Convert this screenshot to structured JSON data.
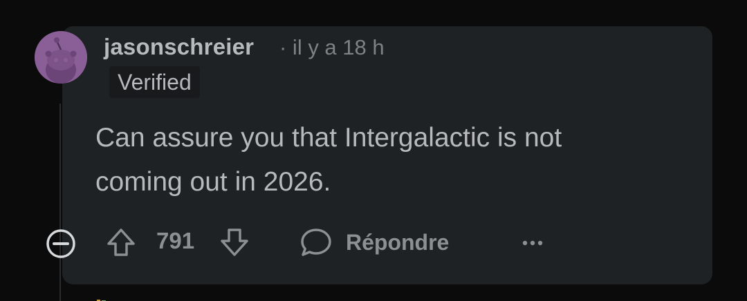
{
  "comment": {
    "username": "jasonschreier",
    "meta": "· il y a 18 h",
    "flair": "Verified",
    "body_line1": "Can assure you that Intergalactic is not",
    "body_line2": "coming out in 2026.",
    "score": "791",
    "reply_label": "Répondre",
    "avatar_color": "#8a5e96"
  },
  "icons": {
    "collapse": "minus-circle-icon",
    "upvote": "upvote-arrow-icon",
    "downvote": "downvote-arrow-icon",
    "reply": "speech-bubble-icon",
    "more": "ellipsis-icon"
  }
}
